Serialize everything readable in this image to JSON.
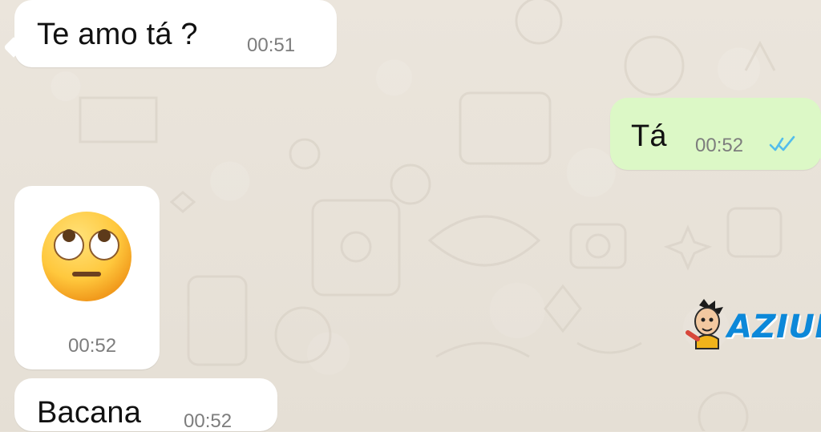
{
  "messages": [
    {
      "text": "Te amo tá ?",
      "time": "00:51"
    },
    {
      "text": "Tá",
      "time": "00:52",
      "status_icon": "double-check-icon"
    },
    {
      "emoji": "rolling-eyes-emoji",
      "time": "00:52"
    },
    {
      "text": "Bacana",
      "time": "00:52"
    }
  ],
  "watermark": {
    "text": "AZIUM",
    "mascot_icon": "cartoon-face-icon"
  },
  "colors": {
    "background": "#e8e2d8",
    "incoming_bubble": "#ffffff",
    "outgoing_bubble": "#dcf8c6",
    "read_check": "#53bdeb",
    "watermark_text": "#0c88d9"
  }
}
